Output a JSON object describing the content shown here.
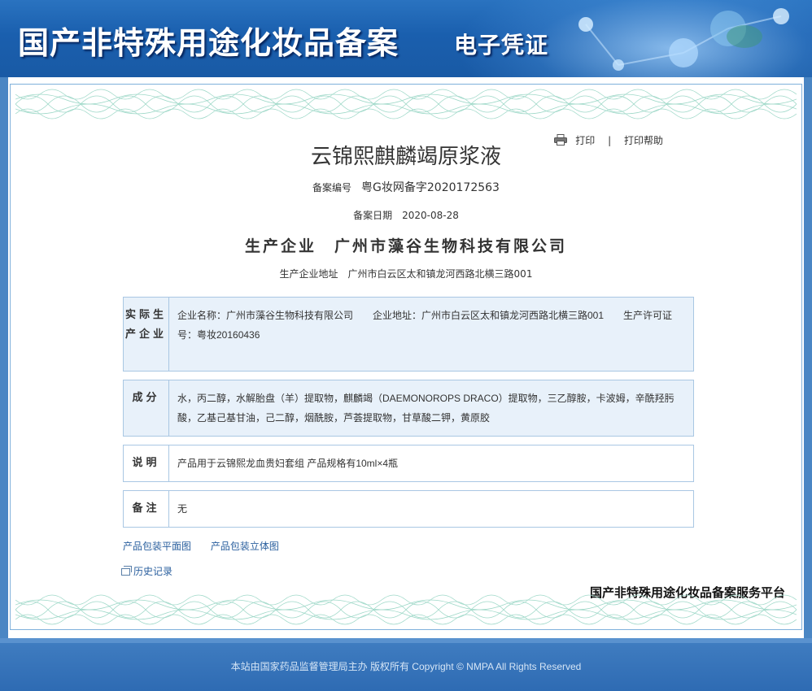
{
  "header": {
    "title": "国产非特殊用途化妆品备案",
    "subtitle": "电子凭证"
  },
  "toolbar": {
    "print_label": "打印",
    "separator": "|",
    "print_help_label": "打印帮助",
    "print_icon": "printer-icon"
  },
  "product": {
    "name": "云锦熙麒麟竭原浆液",
    "registration_label": "备案编号",
    "registration_number": "粤G妆网备字2020172563",
    "date_label": "备案日期",
    "date_value": "2020-08-28",
    "manufacturer_label": "生产企业",
    "manufacturer_name": "广州市藻谷生物科技有限公司",
    "address_label": "生产企业地址",
    "address_value": "广州市白云区太和镇龙河西路北横三路001"
  },
  "sections": {
    "actual_manufacturer": {
      "label": "实际生产企业",
      "content": "企业名称：广州市藻谷生物科技有限公司　　企业地址：广州市白云区太和镇龙河西路北横三路001　　生产许可证号：粤妆20160436"
    },
    "ingredients": {
      "label": "成分",
      "content": "水，丙二醇，水解胎盘（羊）提取物，麒麟竭（DAEMONOROPS DRACO）提取物，三乙醇胺，卡波姆，辛酰羟肟酸，乙基己基甘油，己二醇，烟酰胺，芦荟提取物，甘草酸二钾，黄原胶"
    },
    "description": {
      "label": "说明",
      "content": "产品用于云锦熙龙血贵妇套组 产品规格有10ml×4瓶"
    },
    "remarks": {
      "label": "备注",
      "content": "无"
    }
  },
  "links": {
    "flat_image": "产品包装平面图",
    "3d_image": "产品包装立体图",
    "history": "历史记录"
  },
  "platform_name": "国产非特殊用途化妆品备案服务平台",
  "footer": {
    "text": "本站由国家药品监督管理局主办 版权所有 Copyright © NMPA All Rights Reserved"
  },
  "colors": {
    "banner_blue": "#1a5fae",
    "frame_blue": "#4a86c4",
    "section_shade": "#e8f1fa",
    "link_blue": "#2a5f9e",
    "wave_green": "#9ed8c8"
  }
}
